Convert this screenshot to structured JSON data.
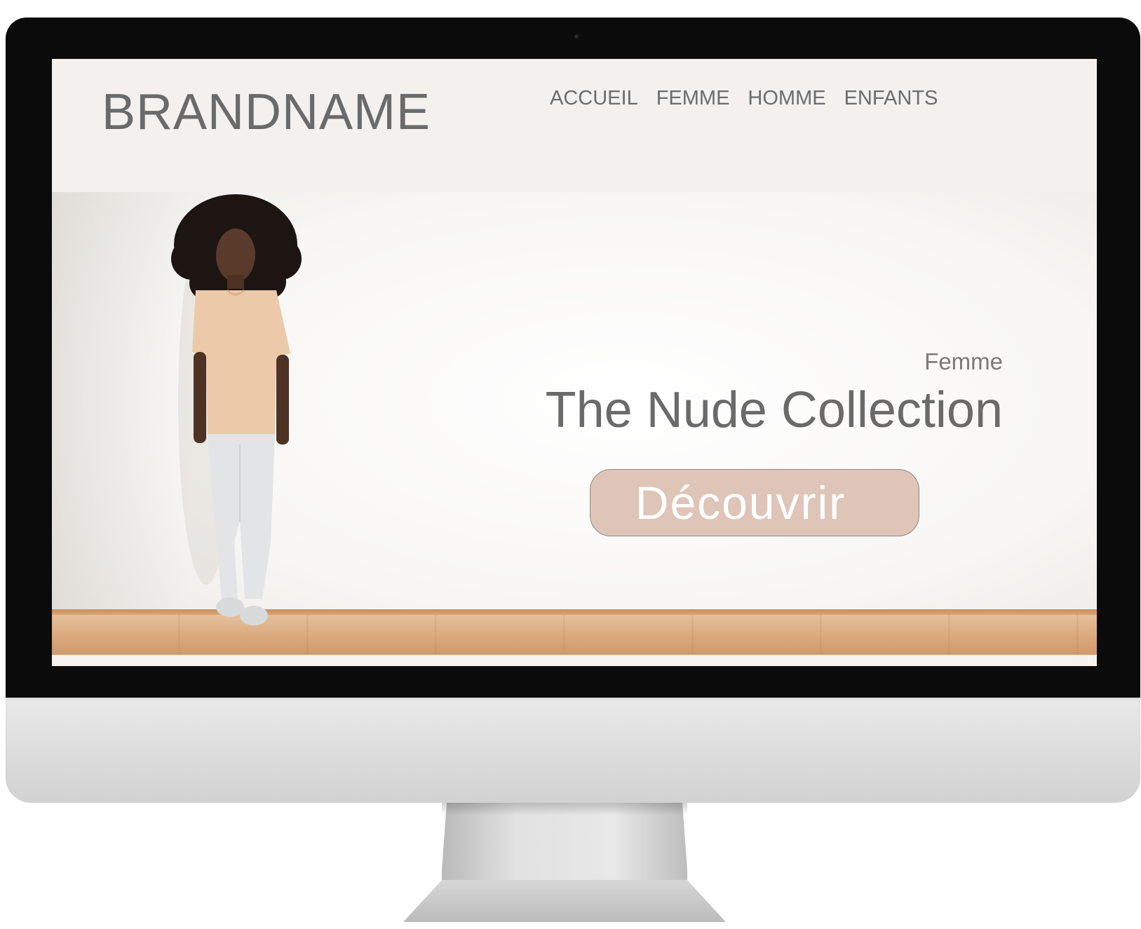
{
  "header": {
    "brand": "BRANDNAME",
    "nav": [
      "ACCUEIL",
      "FEMME",
      "HOMME",
      "ENFANTS"
    ]
  },
  "hero": {
    "eyebrow": "Femme",
    "title": "The Nude Collection",
    "cta_label": "Découvrir"
  },
  "colors": {
    "header_bg": "#f3f0ee",
    "text_gray": "#6a6a6a",
    "cta_bg": "#dfc5b8",
    "cta_text": "#ffffff",
    "floor": "#d9a77a"
  },
  "icons": {
    "model_image": "woman-standing-against-wall-photo"
  }
}
